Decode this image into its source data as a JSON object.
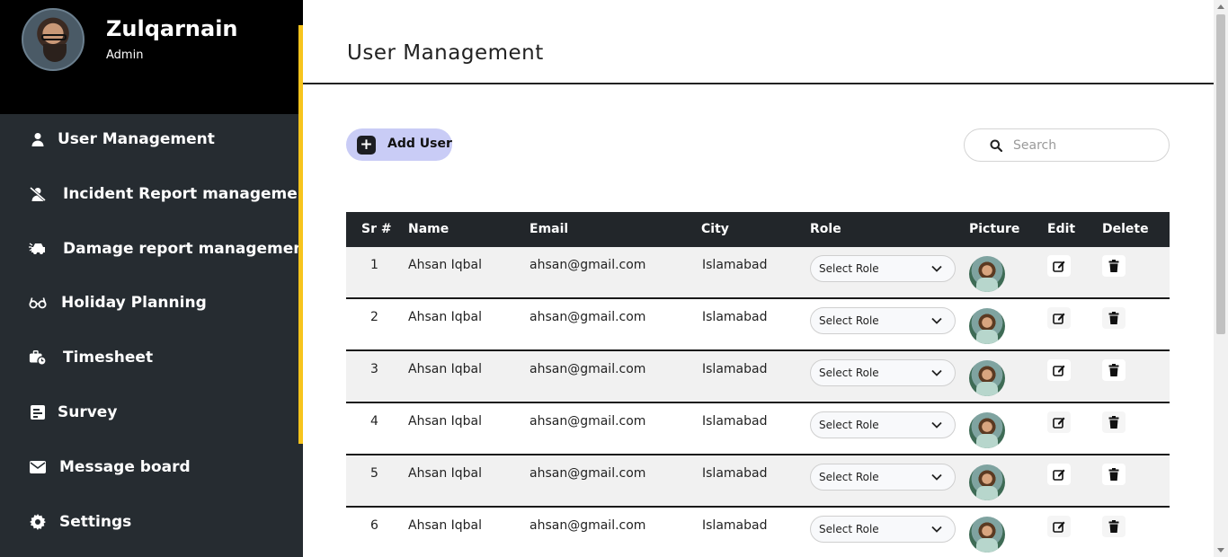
{
  "profile": {
    "name": "Zulqarnain",
    "role": "Admin"
  },
  "sidebar": {
    "items": [
      {
        "label": "User Management",
        "icon": "user-icon"
      },
      {
        "label": "Incident Report management",
        "icon": "user-slash-icon"
      },
      {
        "label": "Damage report management",
        "icon": "car-crash-icon"
      },
      {
        "label": "Holiday Planning",
        "icon": "glasses-icon"
      },
      {
        "label": "Timesheet",
        "icon": "business-time-icon"
      },
      {
        "label": "Survey",
        "icon": "poll-icon"
      },
      {
        "label": "Message board",
        "icon": "envelope-icon"
      },
      {
        "label": "Settings",
        "icon": "gear-icon"
      }
    ]
  },
  "main": {
    "title": "User Management",
    "add_button_label": "Add User",
    "search_placeholder": "Search"
  },
  "table": {
    "headers": [
      "Sr #",
      "Name",
      "Email",
      "City",
      "Role",
      "Picture",
      "Edit",
      "Delete"
    ],
    "rows": [
      {
        "sr": "1",
        "name": "Ahsan Iqbal",
        "email": "ahsan@gmail.com",
        "city": "Islamabad",
        "role": "Select Role"
      },
      {
        "sr": "2",
        "name": "Ahsan Iqbal",
        "email": "ahsan@gmail.com",
        "city": "Islamabad",
        "role": "Select Role"
      },
      {
        "sr": "3",
        "name": "Ahsan Iqbal",
        "email": "ahsan@gmail.com",
        "city": "Islamabad",
        "role": "Select Role"
      },
      {
        "sr": "4",
        "name": "Ahsan Iqbal",
        "email": "ahsan@gmail.com",
        "city": "Islamabad",
        "role": "Select Role"
      },
      {
        "sr": "5",
        "name": "Ahsan Iqbal",
        "email": "ahsan@gmail.com",
        "city": "Islamabad",
        "role": "Select Role"
      },
      {
        "sr": "6",
        "name": "Ahsan Iqbal",
        "email": "ahsan@gmail.com",
        "city": "Islamabad",
        "role": "Select Role"
      }
    ]
  },
  "colors": {
    "sidebar_bg": "#262c31",
    "profile_bg": "#000000",
    "accent": "#f7c41d",
    "add_button_bg": "#c9ccf6",
    "table_header_bg": "#22262a"
  }
}
